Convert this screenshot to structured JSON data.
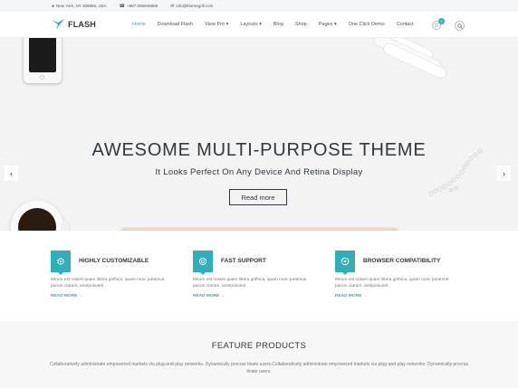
{
  "topbar": {
    "address": "New York, NY 308865, USA",
    "phone": "+987-265946868",
    "email": "info@themegrill.com"
  },
  "header": {
    "logo_text": "FLASH",
    "nav": [
      "Home",
      "Download Flash",
      "View Pro ▾",
      "Layouts ▾",
      "Blog",
      "Shop",
      "Pages ▾",
      "One Click Demo",
      "Contact"
    ],
    "active_index": 0,
    "cart_count": "0"
  },
  "hero": {
    "title": "AWESOME MULTI-PURPOSE THEME",
    "subtitle": "It Looks Perfect On Any Device And Retina Display",
    "button": "Read more",
    "prev": "‹",
    "next": "›"
  },
  "features": [
    {
      "title": "HIGHLY CUSTOMIZABLE",
      "desc": "Mirum est notare quam littera gothica, quam nunc putamus parum claram, anteposuerit",
      "link": "READ MORE →",
      "icon": "gear-icon"
    },
    {
      "title": "FAST SUPPORT",
      "desc": "Mirum est notare quam littera gothica, quam nunc putamus parum claram, anteposuerit",
      "link": "READ MORE →",
      "icon": "support-icon"
    },
    {
      "title": "BROWSER COMPATIBILITY",
      "desc": "Mirum est notare quam littera gothica, quam nunc putamus parum claram, anteposuerit",
      "link": "READ MORE →",
      "icon": "browser-icon"
    }
  ],
  "products": {
    "title": "FEATURE PRODUCTS",
    "desc": "Collaboratively administrate empowered markets via plug-and-play networks. Dynamically procras tinate users.Collaboratively administrate empowered markets via plug-and-play networks. Dynamically procras tinate users."
  },
  "colors": {
    "accent": "#30afb8",
    "text": "#30373e"
  }
}
